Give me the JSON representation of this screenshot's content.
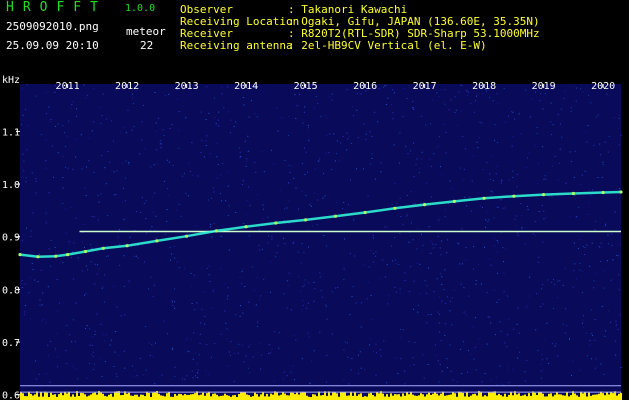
{
  "header": {
    "app_title": "HROFFT",
    "app_version": "1.0.0",
    "filename": "2509092010.png",
    "datetime": "25.09.09 20:10",
    "meteor_label": "meteor",
    "meteor_count": "22",
    "info": [
      {
        "label": "Observer",
        "value": ": Takanori Kawachi"
      },
      {
        "label": "Receiving Location",
        "value": ": Ogaki, Gifu, JAPAN (136.60E, 35.35N)"
      },
      {
        "label": "Receiver",
        "value": ": R820T2(RTL-SDR) SDR-Sharp 53.1000MHz"
      },
      {
        "label": "Receiving antenna",
        "value": ": 2el-HB9CV Vertical (el. E-W)"
      }
    ]
  },
  "colors": {
    "background": "#000000",
    "plot_background": "#0a0a5a",
    "label_green": "#22dd22",
    "label_yellow": "#ffff33",
    "trace_cyan": "#33ffdd",
    "ref_line": "#ccffcc",
    "baseline_fill": "#ffee00"
  },
  "chart_data": {
    "type": "line",
    "ylabel": "kHz",
    "x_tick_labels": [
      "2011",
      "2012",
      "2013",
      "2014",
      "2015",
      "2016",
      "2017",
      "2018",
      "2019",
      "2020"
    ],
    "y_tick_labels": [
      "1.1",
      "1.0",
      "0.9",
      "0.8",
      "0.7",
      "0.6"
    ],
    "x_ticks": [
      2011,
      2012,
      2013,
      2014,
      2015,
      2016,
      2017,
      2018,
      2019,
      2020
    ],
    "y_ticks": [
      1.1,
      1.0,
      0.9,
      0.8,
      0.7,
      0.6
    ],
    "xlim": [
      2010.2,
      2020.3
    ],
    "ylim": [
      0.59,
      1.19
    ],
    "series": [
      {
        "x": [
          2010.2,
          2010.5,
          2010.8,
          2011.0,
          2011.3,
          2011.6,
          2012.0,
          2012.5,
          2013.0,
          2013.5,
          2014.0,
          2014.5,
          2015.0,
          2015.5,
          2016.0,
          2016.5,
          2017.0,
          2017.5,
          2018.0,
          2018.5,
          2019.0,
          2019.5,
          2020.0,
          2020.3
        ],
        "y": [
          0.866,
          0.862,
          0.863,
          0.866,
          0.872,
          0.878,
          0.883,
          0.892,
          0.901,
          0.911,
          0.919,
          0.926,
          0.932,
          0.939,
          0.946,
          0.954,
          0.961,
          0.967,
          0.973,
          0.977,
          0.98,
          0.982,
          0.984,
          0.985
        ]
      }
    ],
    "reference_lines": [
      {
        "y": 0.91,
        "x_from": 2011.2,
        "x_to": 2020.3
      },
      {
        "y": 0.617,
        "x_from": 2010.2,
        "x_to": 2020.3
      },
      {
        "y": 0.605,
        "x_from": 2010.2,
        "x_to": 2020.3
      }
    ],
    "grid": false
  }
}
